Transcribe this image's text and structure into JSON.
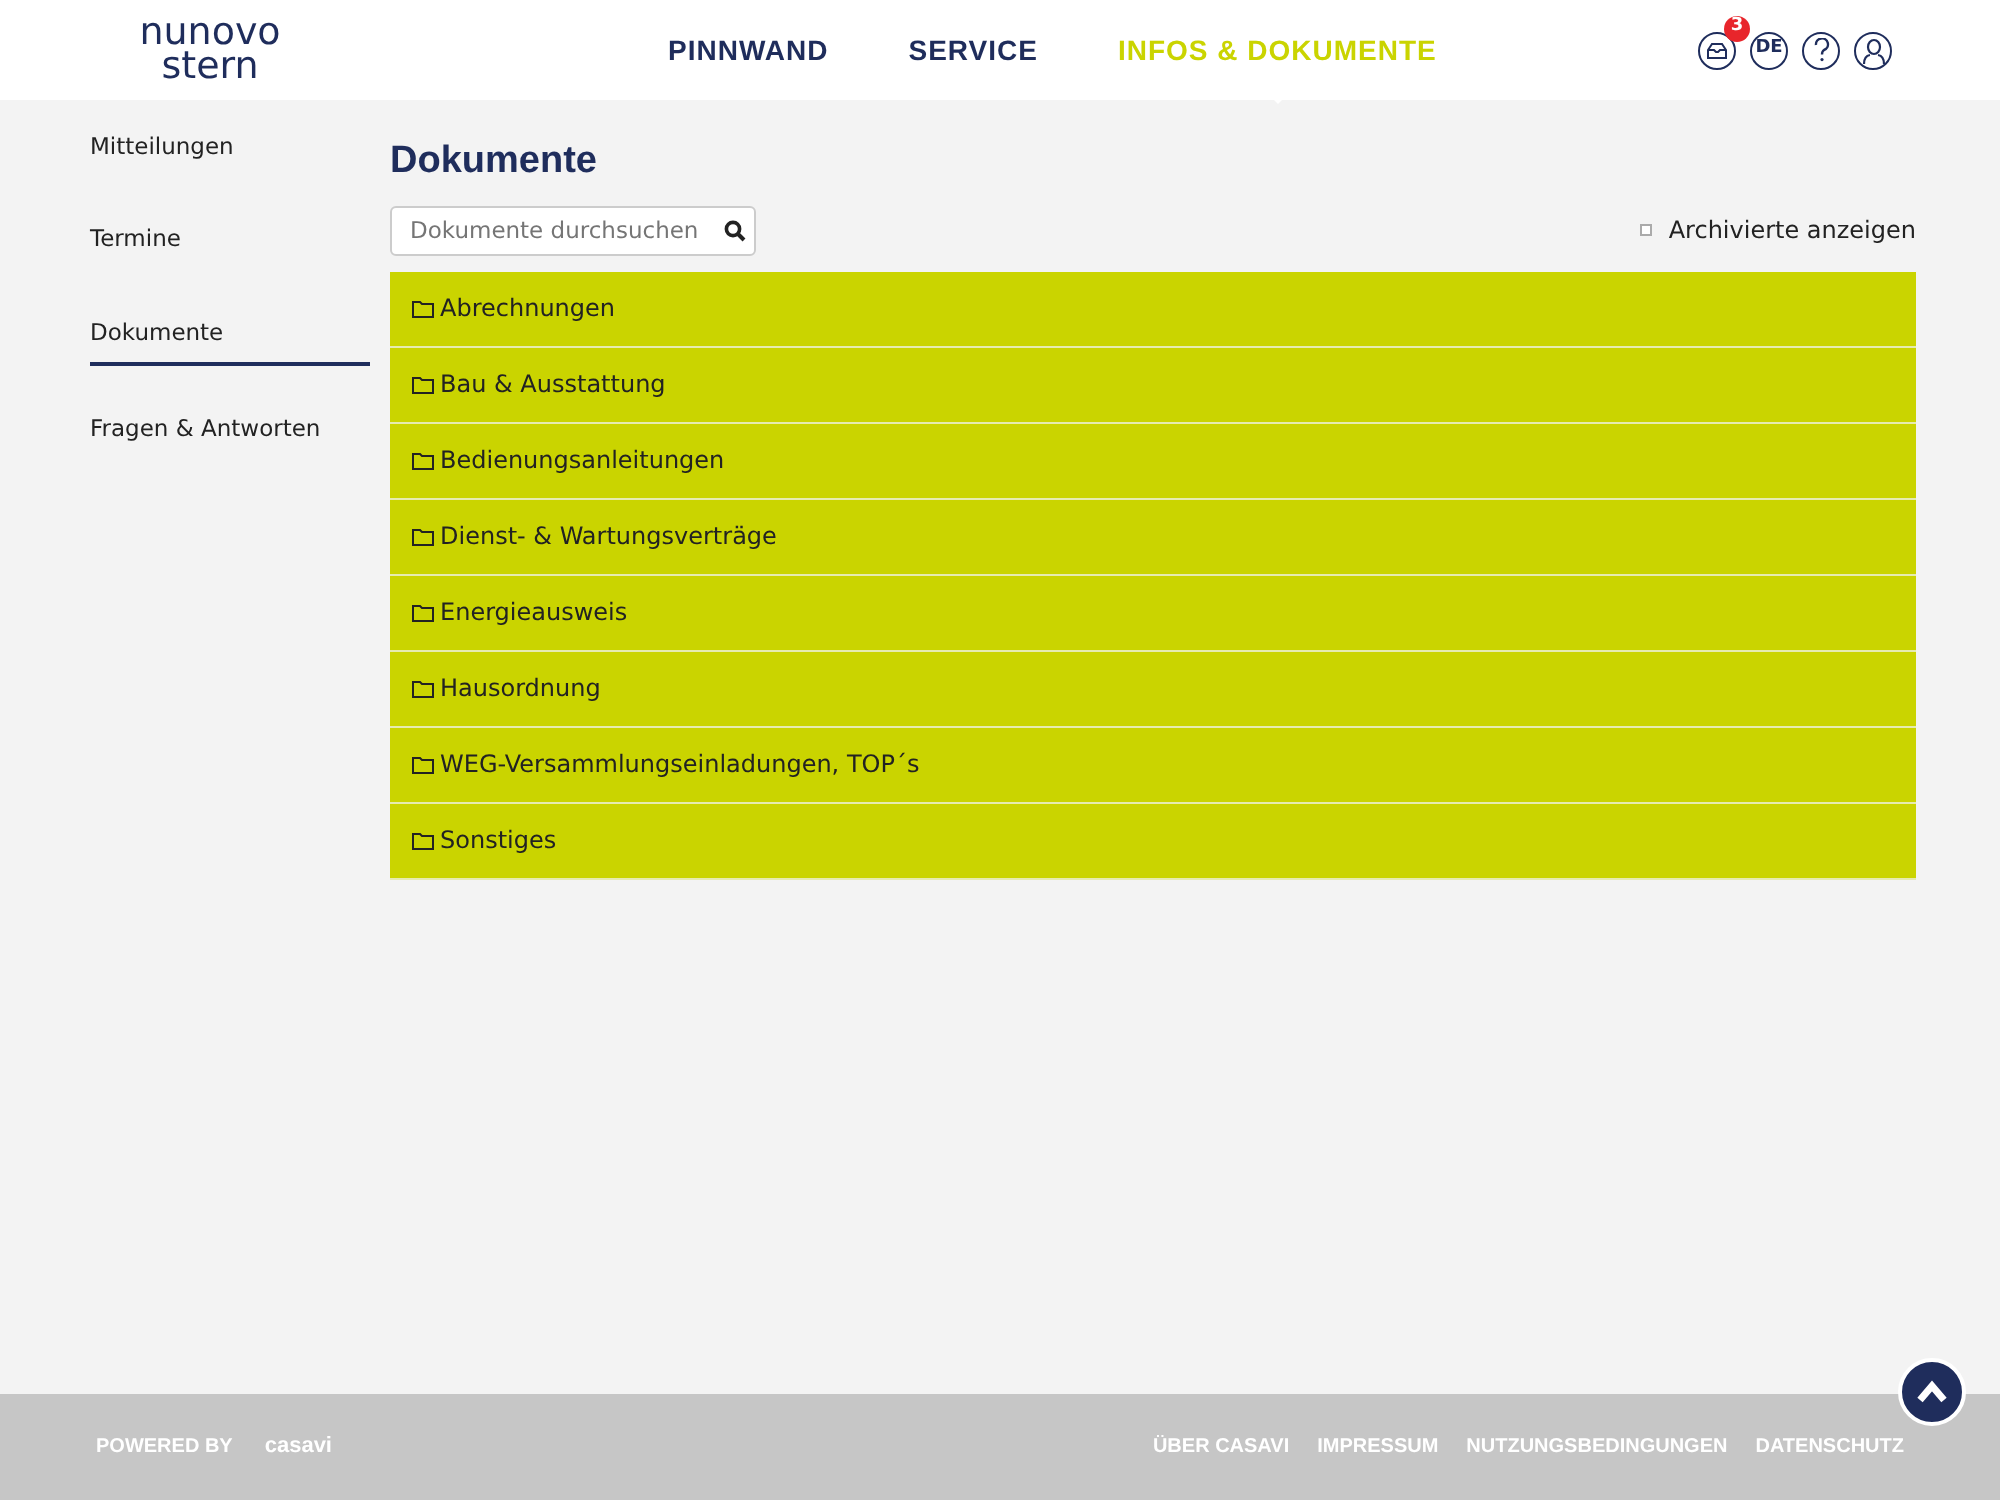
{
  "header": {
    "logo": {
      "line1": "nunovo",
      "line2": "stern"
    },
    "nav": [
      {
        "label": "PINNWAND",
        "selected": false
      },
      {
        "label": "SERVICE",
        "selected": false
      },
      {
        "label": "INFOS & DOKUMENTE",
        "selected": true
      }
    ],
    "notification_count": "3",
    "language": "DE"
  },
  "sidebar": {
    "items": [
      {
        "label": "Mitteilungen",
        "selected": false
      },
      {
        "label": "Termine",
        "selected": false
      },
      {
        "label": "Dokumente",
        "selected": true
      },
      {
        "label": "Fragen & Antworten",
        "selected": false
      }
    ]
  },
  "main": {
    "title": "Dokumente",
    "search": {
      "placeholder": "Dokumente durchsuchen"
    },
    "archived": {
      "label": "Archivierte anzeigen",
      "checked": false
    },
    "folders": [
      {
        "label": "Abrechnungen"
      },
      {
        "label": "Bau & Ausstattung"
      },
      {
        "label": "Bedienungsanleitungen"
      },
      {
        "label": "Dienst- & Wartungsverträge"
      },
      {
        "label": "Energieausweis"
      },
      {
        "label": "Hausordnung"
      },
      {
        "label": "WEG-Versammlungseinladungen, TOP´s"
      },
      {
        "label": "Sonstiges"
      }
    ]
  },
  "footer": {
    "powered_by": "POWERED BY",
    "brand": "casavi",
    "links": [
      "ÜBER CASAVI",
      "IMPRESSUM",
      "NUTZUNGSBEDINGUNGEN",
      "DATENSCHUTZ"
    ]
  }
}
